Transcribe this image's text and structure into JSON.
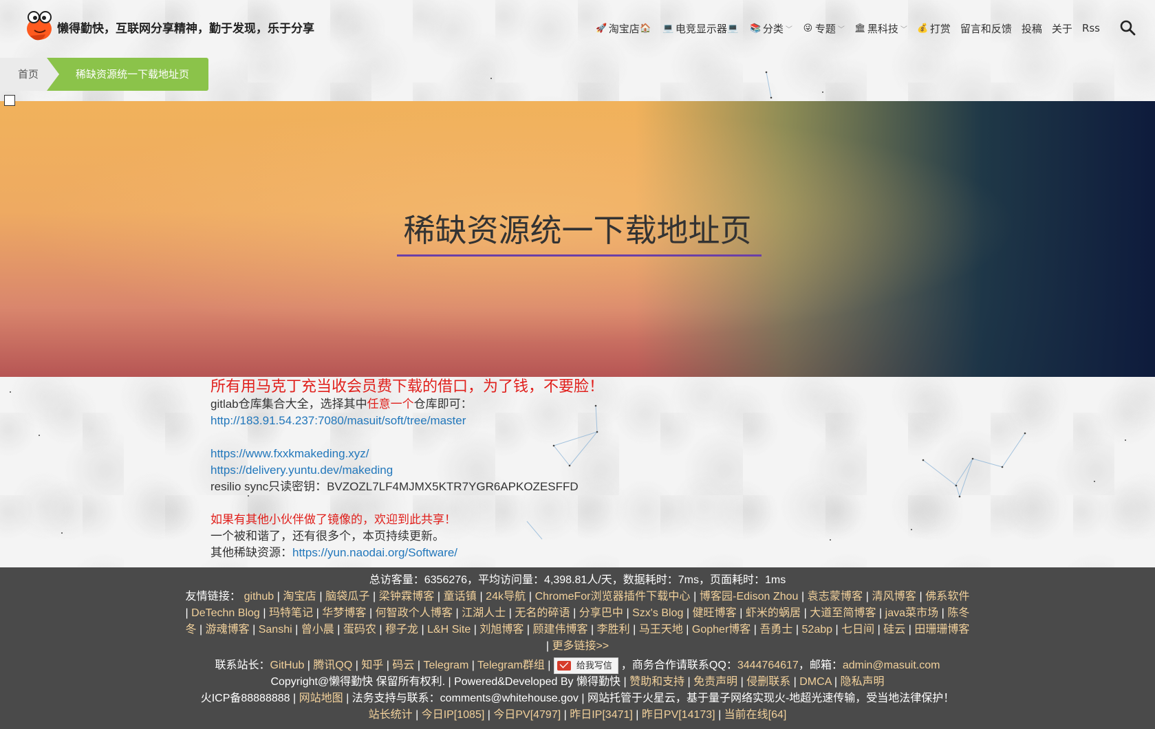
{
  "header": {
    "site_title": "懒得勤快，互联网分享精神，勤于发现，乐于分享",
    "nav": [
      {
        "label": "淘宝店",
        "icon": "rocket-icon",
        "icon2": "shop-icon"
      },
      {
        "label": "电竞显示器",
        "icon": "laptop-icon",
        "icon2": "laptop-icon"
      },
      {
        "label": "分类",
        "icon": "layers-icon",
        "has_dropdown": true
      },
      {
        "label": "专题",
        "icon": "emoji-icon",
        "has_dropdown": true
      },
      {
        "label": "黑科技",
        "icon": "building-icon",
        "has_dropdown": true
      },
      {
        "label": "打赏",
        "icon": "money-bag-icon"
      },
      {
        "label": "留言和反馈"
      },
      {
        "label": "投稿"
      },
      {
        "label": "关于"
      },
      {
        "label": "Rss"
      }
    ]
  },
  "breadcrumb": {
    "home": "首页",
    "current": "稀缺资源统一下载地址页"
  },
  "banner": {
    "title": "稀缺资源统一下载地址页"
  },
  "content": {
    "headline": "所有用马克丁充当收会员费下载的借口，为了钱，不要脸！",
    "gitlab_prefix": "gitlab仓库集合大全，选择其中",
    "gitlab_highlight": "任意一个",
    "gitlab_suffix": "仓库即可：",
    "gitlab_url": "http://183.91.54.237:7080/masuit/soft/tree/master",
    "url2": "https://www.fxxkmakeding.xyz/",
    "url3": "https://delivery.yuntu.dev/makeding",
    "resilio": "resilio sync只读密钥：BVZOZL7LF4MJMX5KTR7YGR6APKOZESFFD",
    "mirror_note": "如果有其他小伙伴做了镜像的，欢迎到此共享！",
    "update_note": "一个被和谐了，还有很多个，本页持续更新。",
    "other_prefix": "其他稀缺资源：",
    "other_url": "https://yun.naodai.org/Software/"
  },
  "footer": {
    "stats": "总访客量：6356276，平均访问量：4,398.81人/天，数据耗时：7ms，页面耗时：1ms",
    "friends_label": "友情链接：",
    "friends": [
      "github",
      "淘宝店",
      "脑袋瓜子",
      "梁钟霖博客",
      "童话镇",
      "24k导航",
      "ChromeFor浏览器插件下载中心",
      "博客园-Edison Zhou",
      "袁志蒙博客",
      "清风博客",
      "佛系软件",
      "DeTechn Blog",
      "玛特笔记",
      "华梦博客",
      "何智政个人博客",
      "江湖人士",
      "无名的碎语",
      "分享巴中",
      "Szx's Blog",
      "健旺博客",
      "虾米的蜗居",
      "大道至简博客",
      "java菜市场",
      "陈冬冬",
      "游魂博客",
      "Sanshi",
      "曾小晨",
      "蛋码农",
      "穆子龙",
      "L&H Site",
      "刘旭博客",
      "顾建伟博客",
      "李胜利",
      "马王天地",
      "Gopher博客",
      "吾勇士",
      "52abp",
      "七日间",
      "硅云",
      "田珊珊博客",
      "更多链接>>"
    ],
    "contact_label": "联系站长：",
    "contacts": [
      "GitHub",
      "腾讯QQ",
      "知乎",
      "码云",
      "Telegram",
      "Telegram群组"
    ],
    "mail_button": "给我写信",
    "biz_prefix": "，商务合作请联系QQ：",
    "biz_qq": "3444764617",
    "email_prefix": "，邮箱：",
    "email": "admin@masuit.com",
    "copyright_a": "Copyright@懒得勤快 保留所有权利. | Powered&Developed By 懒得勤快 |",
    "copyright_links": [
      "赞助和支持",
      "免责声明",
      "侵删联系",
      "DMCA",
      "隐私声明"
    ],
    "icp": "火ICP备88888888",
    "sitemap": "网站地图",
    "legal": "| 法务支持与联系：comments@whitehouse.gov | 网站托管于火星云，基于量子网络实现火-地超光速传输，受当地法律保护！",
    "stats_links": [
      "站长统计",
      "今日IP[1085]",
      "今日PV[4797]",
      "昨日IP[3471]",
      "昨日PV[14173]",
      "当前在线[64]"
    ]
  },
  "colors": {
    "accent_green": "#8bc34a",
    "link_blue": "#2277bb",
    "alert_red": "#e0201c",
    "footer_bg": "#4a4a4a",
    "footer_link": "#f2d19b",
    "banner_underline": "#6a3fa8"
  }
}
